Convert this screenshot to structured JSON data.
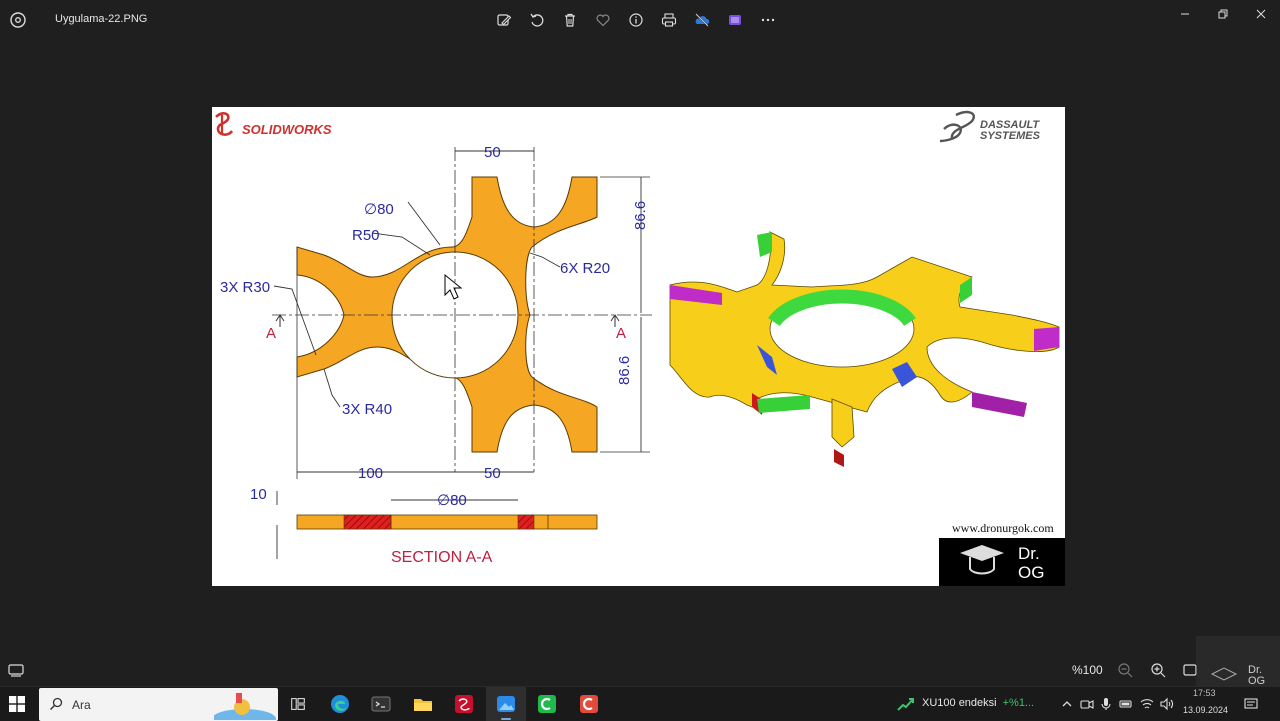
{
  "window": {
    "title": "Uygulama-22.PNG",
    "icons": [
      "photos-app-icon",
      "edit-icon",
      "rotate-icon",
      "delete-icon",
      "favorite-icon",
      "info-icon",
      "print-icon",
      "onedrive-icon",
      "clipchamp-icon",
      "more-icon",
      "minimize-icon",
      "restore-icon",
      "close-icon"
    ]
  },
  "drawing": {
    "brand_left": "SOLIDWORKS",
    "brand_right_1": "DASSAULT",
    "brand_right_2": "SYSTEMES",
    "dim_top_50": "50",
    "dim_dia80": "∅80",
    "dim_r50": "R50",
    "dim_6xr20": "6X R20",
    "dim_3xr30": "3X R30",
    "dim_3xr40": "3X R40",
    "dim_86_6_top": "86.6",
    "dim_86_6_bottom": "86.6",
    "dim_100": "100",
    "dim_bottom_50": "50",
    "dim_10": "10",
    "dim_section_dia80": "∅80",
    "section_label": "SECTION A-A",
    "section_mark_left": "A",
    "section_mark_right": "A",
    "website": "www.dronurgok.com",
    "logo_line1": "Dr.",
    "logo_line2": "OG",
    "part_color": "#f5a623",
    "section_hatch_color": "#e02020",
    "dim_color": "#2a2aa0"
  },
  "bottom_bar": {
    "zoom": "%100"
  },
  "taskbar": {
    "search_placeholder": "Ara",
    "stock_name": "XU100 endeksi",
    "stock_change": "+%1...",
    "time": "17:53",
    "date": "13.09.2024",
    "watermark_1": "Dr.",
    "watermark_2": "OG"
  }
}
